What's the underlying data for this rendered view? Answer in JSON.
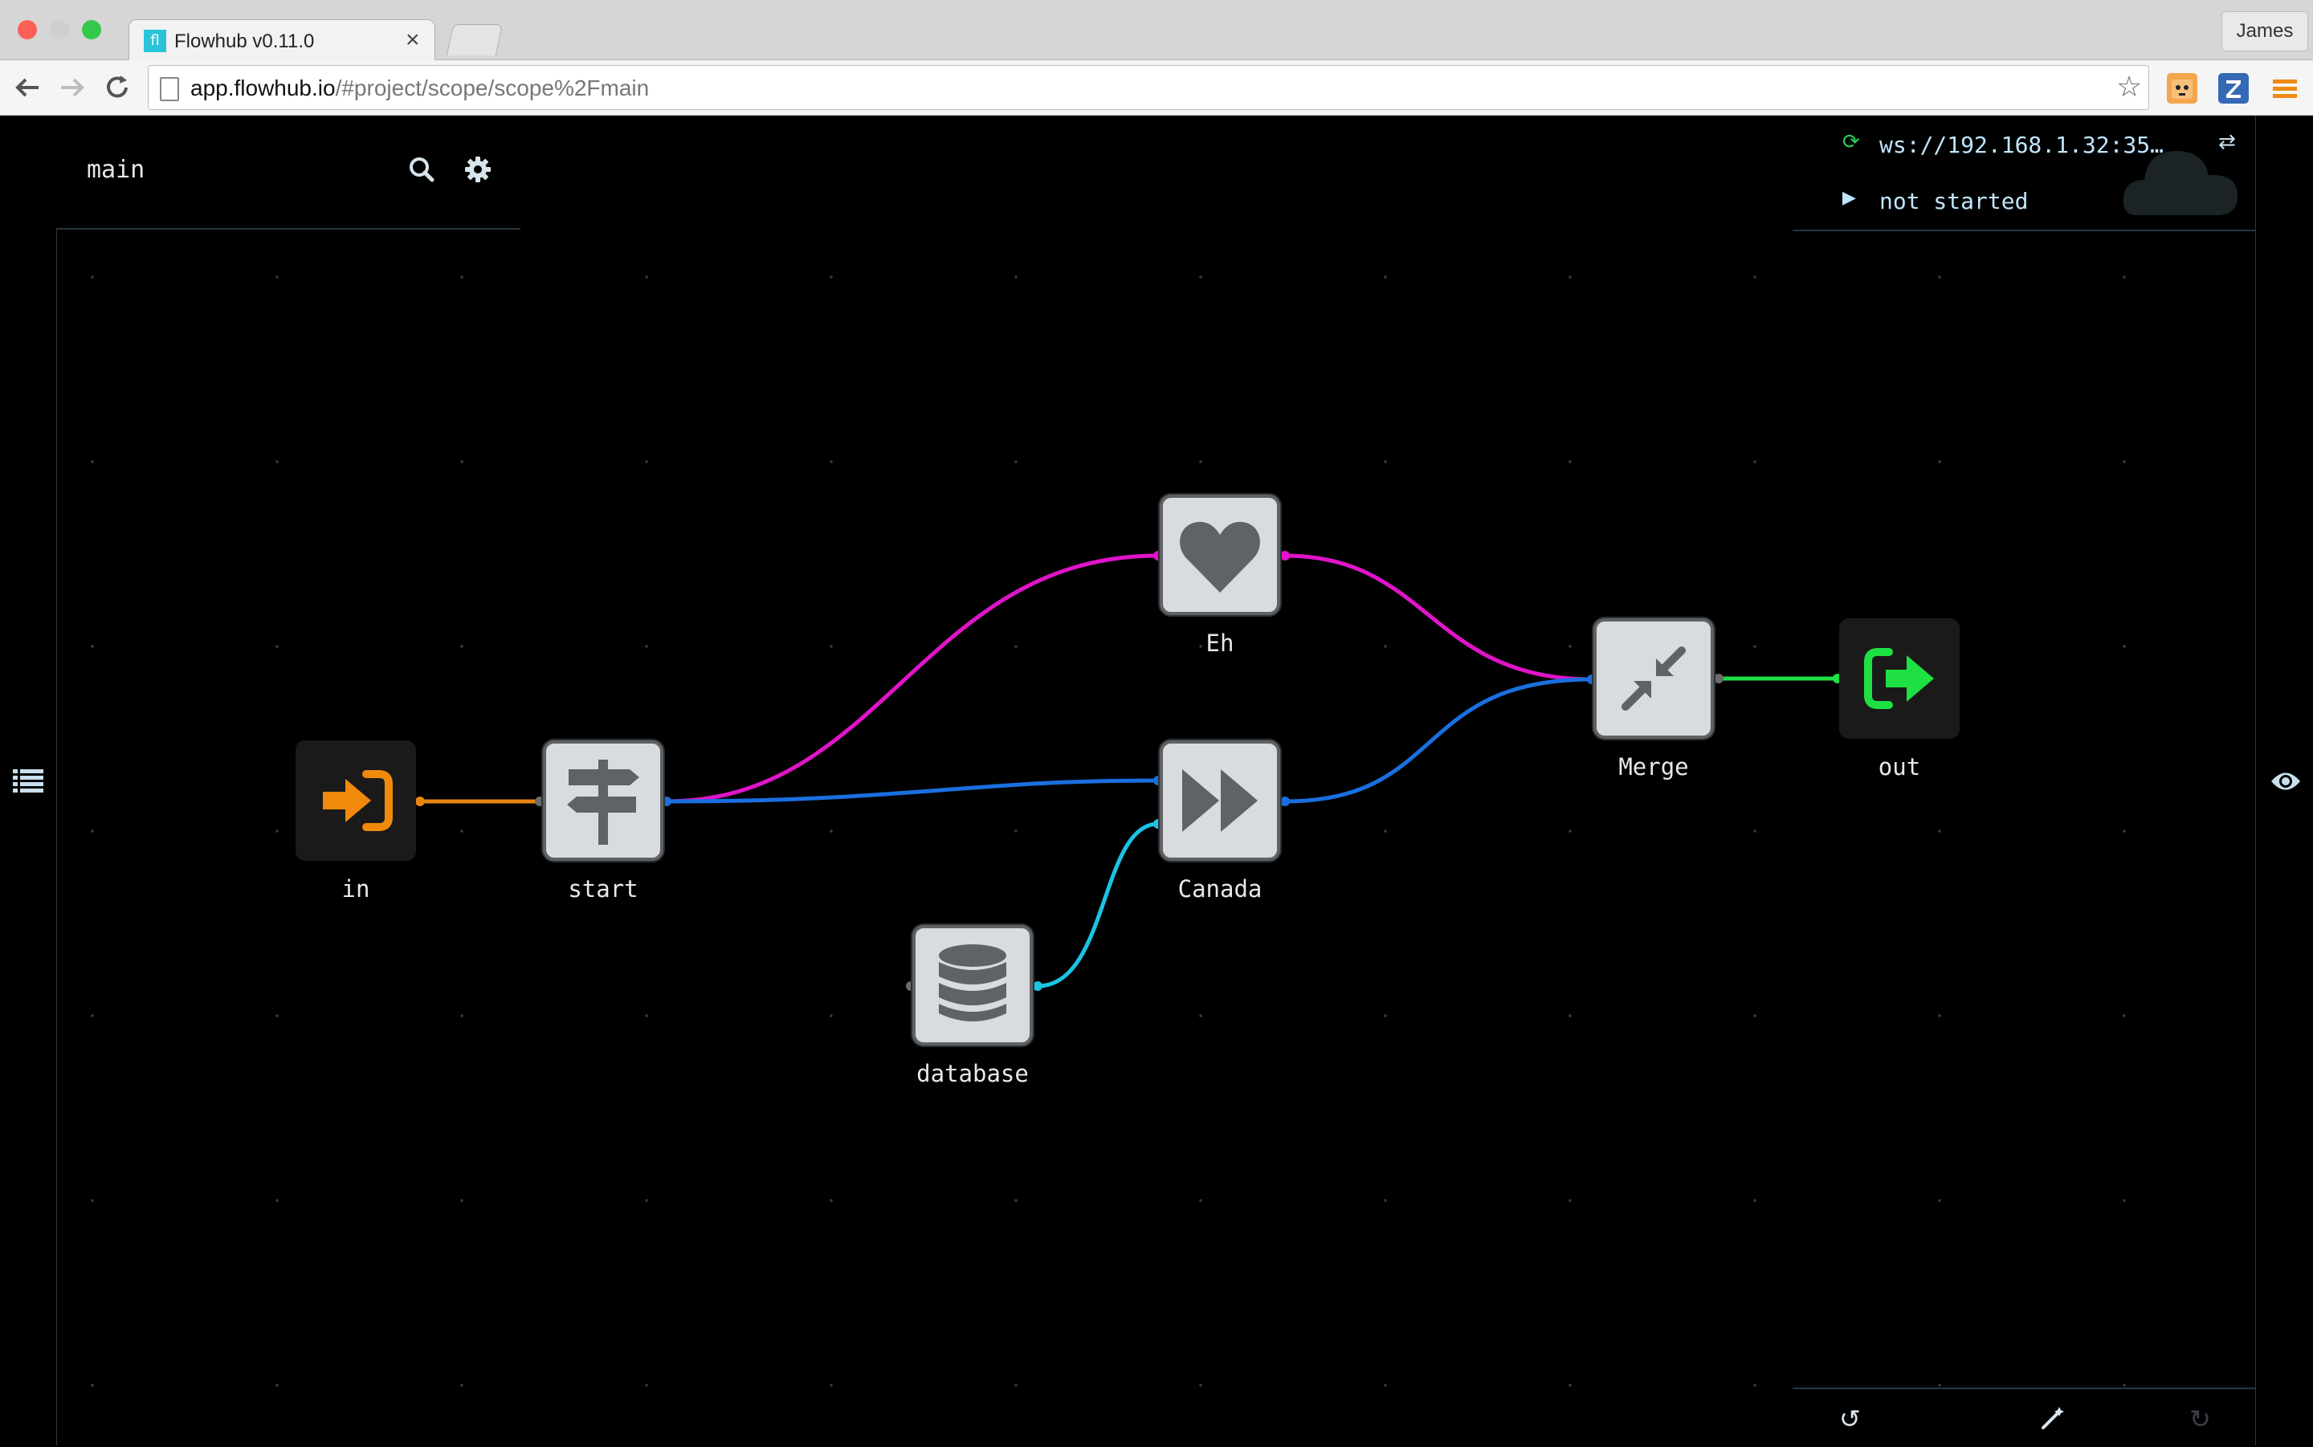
{
  "browser": {
    "tab_title": "Flowhub v0.11.0",
    "favicon_text": "fl",
    "tab_close": "×",
    "profile_name": "James",
    "url_host": "app.flowhub.io",
    "url_path": "/#project/scope/scope%2Fmain",
    "back_icon": "back-arrow-icon",
    "forward_icon": "forward-arrow-icon",
    "reload_icon": "reload-icon",
    "star_icon": "bookmark-star-icon"
  },
  "editor": {
    "graph_name": "main",
    "search_icon": "search-icon",
    "settings_icon": "gear-icon"
  },
  "runtime": {
    "url": "ws://192.168.1.32:35…",
    "status": "not started",
    "sync_glyph": "⟳",
    "swap_glyph": "⇄",
    "play_glyph": "▶"
  },
  "bottom_bar": {
    "undo_glyph": "↺",
    "redo_glyph": "↻",
    "magic_glyph": "✎"
  },
  "nodes": [
    {
      "id": "in",
      "label": "in",
      "icon": "sign-in-icon",
      "color": "#f0890c"
    },
    {
      "id": "start",
      "label": "start",
      "icon": "signpost-icon",
      "color": "#5f6366"
    },
    {
      "id": "eh",
      "label": "Eh",
      "icon": "heart-icon",
      "color": "#5f6366"
    },
    {
      "id": "canada",
      "label": "Canada",
      "icon": "fast-forward-icon",
      "color": "#5f6366"
    },
    {
      "id": "database",
      "label": "database",
      "icon": "database-icon",
      "color": "#5f6366"
    },
    {
      "id": "merge",
      "label": "Merge",
      "icon": "compress-icon",
      "color": "#5f6366"
    },
    {
      "id": "out",
      "label": "out",
      "icon": "sign-out-icon",
      "color": "#1ee043"
    }
  ],
  "edges": [
    {
      "from": "in",
      "to": "start",
      "color": "#e8850f"
    },
    {
      "from": "start",
      "to": "eh",
      "color": "#e014c8"
    },
    {
      "from": "start",
      "to": "canada",
      "color": "#1a6fe0"
    },
    {
      "from": "database",
      "to": "canada",
      "color": "#1cc3e3"
    },
    {
      "from": "eh",
      "to": "merge",
      "color": "#e014c8"
    },
    {
      "from": "canada",
      "to": "merge",
      "color": "#1a6fe0"
    },
    {
      "from": "merge",
      "to": "out",
      "color": "#1ee043"
    }
  ]
}
